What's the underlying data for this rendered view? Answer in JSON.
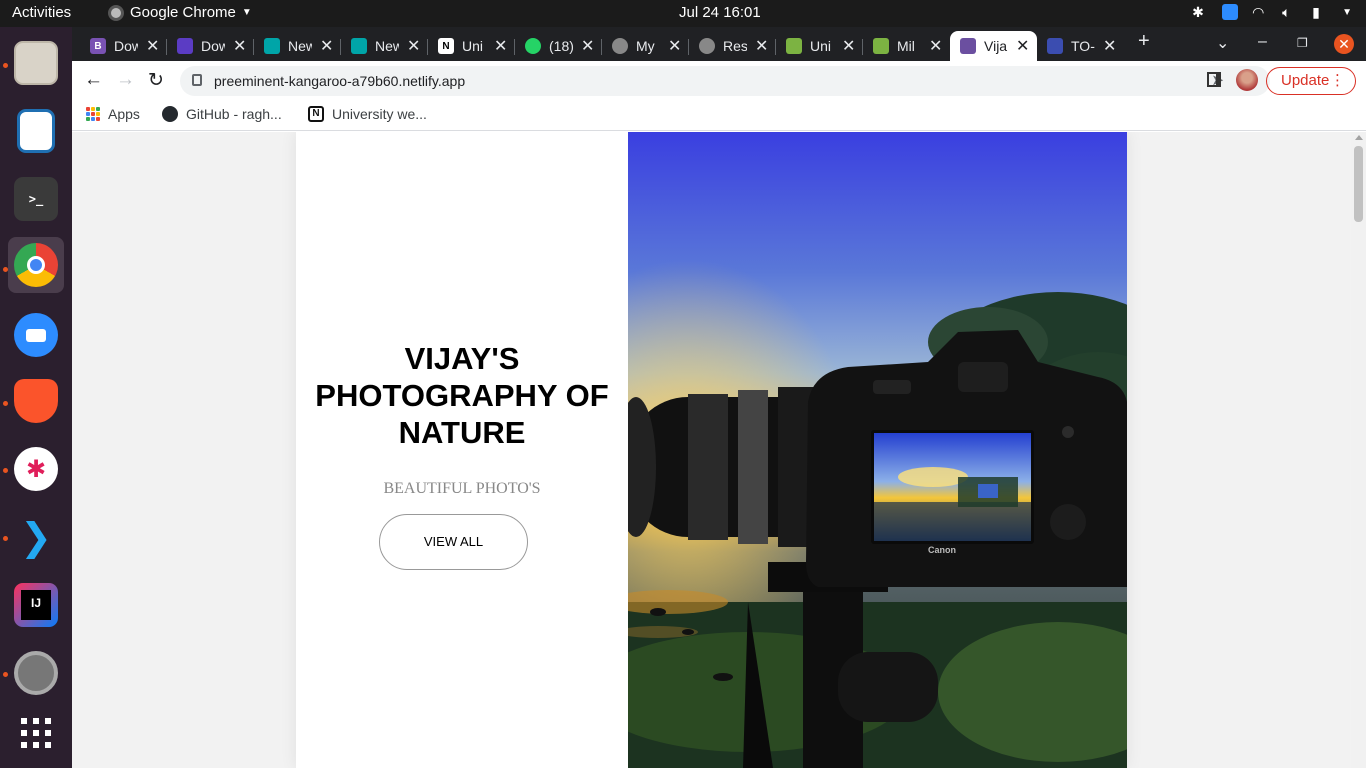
{
  "topbar": {
    "activities": "Activities",
    "app_name": "Google Chrome",
    "clock": "Jul 24  16:01"
  },
  "dock": {
    "apps": [
      "files",
      "libreoffice-impress",
      "terminal",
      "chrome",
      "zoom",
      "brave",
      "slack",
      "vscode",
      "intellij",
      "settings",
      "show-applications"
    ]
  },
  "tabs": [
    {
      "label": "Dow",
      "favicon": "bootstrap",
      "color": "#7952b3"
    },
    {
      "label": "Dow",
      "favicon": "download",
      "color": "#5b3cc4"
    },
    {
      "label": "New",
      "favicon": "mongodb-shield",
      "color": "#00a5a8"
    },
    {
      "label": "New",
      "favicon": "mongodb-shield",
      "color": "#00a5a8"
    },
    {
      "label": "Uni",
      "favicon": "notion",
      "color": "#ffffff"
    },
    {
      "label": "(18)",
      "favicon": "whatsapp",
      "color": "#25d366"
    },
    {
      "label": "My",
      "favicon": "globe",
      "color": "#888888"
    },
    {
      "label": "Res",
      "favicon": "globe",
      "color": "#888888"
    },
    {
      "label": "Uni",
      "favicon": "p-green",
      "color": "#7cb342"
    },
    {
      "label": "Mil",
      "favicon": "p-green",
      "color": "#7cb342"
    },
    {
      "label": "Vija",
      "favicon": "site",
      "color": "#6b4fa0",
      "active": true
    },
    {
      "label": "TO-",
      "favicon": "doc",
      "color": "#3b4db0"
    }
  ],
  "toolbar": {
    "url": "preeminent-kangaroo-a79b60.netlify.app",
    "update_label": "Update"
  },
  "bookmarks": [
    {
      "label": "Apps",
      "icon": "apps-grid"
    },
    {
      "label": "GitHub - ragh...",
      "icon": "github"
    },
    {
      "label": "University we...",
      "icon": "notion"
    }
  ],
  "page": {
    "title_lines": [
      "VIJAY'S",
      "PHOTOGRAPHY OF",
      "NATURE"
    ],
    "subtitle": "BEAUTIFUL PHOTO'S",
    "button_label": "VIEW ALL"
  }
}
